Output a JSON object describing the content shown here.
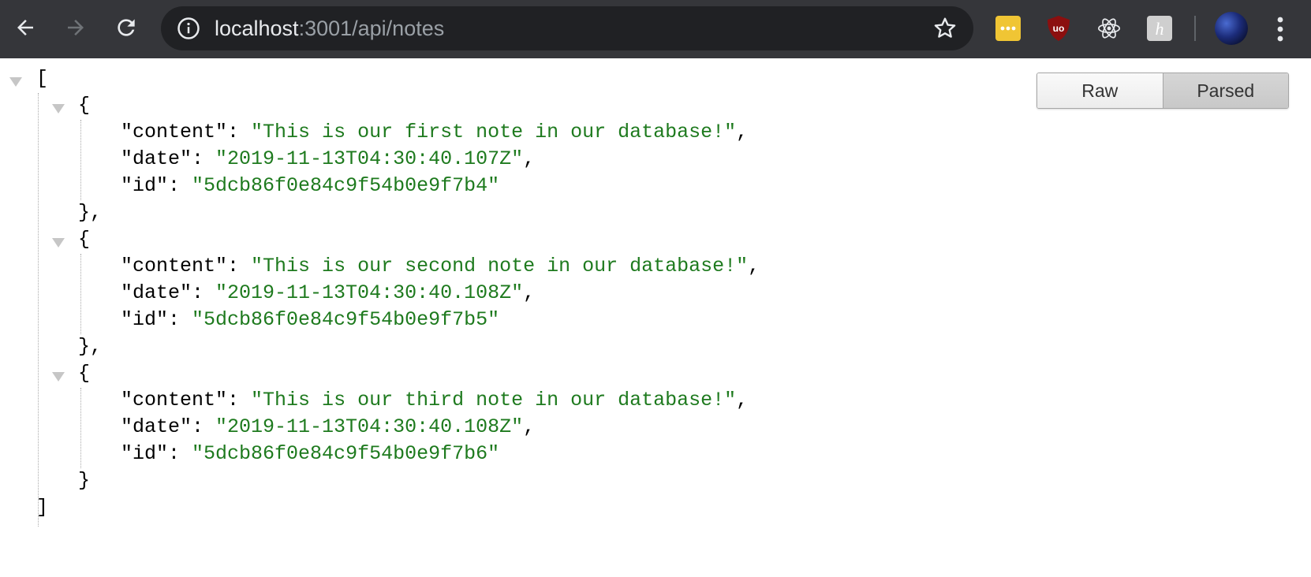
{
  "browser": {
    "url_host": "localhost",
    "url_rest": ":3001/api/notes",
    "icons": [
      "back-arrow-icon",
      "forward-arrow-icon",
      "reload-icon",
      "info-icon",
      "star-icon",
      "menu-dots-icon"
    ],
    "extensions": [
      {
        "name": "lastpass-extension-icon",
        "text": "•••",
        "color": "#f0c534"
      },
      {
        "name": "ublock-origin-extension-icon",
        "text": "uo",
        "color": "#8b0f0f"
      },
      {
        "name": "react-devtools-extension-icon",
        "text": "",
        "color": "#e8eaed"
      },
      {
        "name": "honey-extension-icon",
        "text": "h",
        "color": "#cfcfcf"
      }
    ]
  },
  "viewer": {
    "raw_label": "Raw",
    "parsed_label": "Parsed",
    "selected": "Parsed"
  },
  "json": {
    "open_bracket": "[",
    "close_bracket": "]",
    "notes": [
      {
        "content_key": "\"content\"",
        "content": "\"This is our first note in our database!\"",
        "date_key": "\"date\"",
        "date": "\"2019-11-13T04:30:40.107Z\"",
        "id_key": "\"id\"",
        "id": "\"5dcb86f0e84c9f54b0e9f7b4\"",
        "close": "},"
      },
      {
        "content_key": "\"content\"",
        "content": "\"This is our second note in our database!\"",
        "date_key": "\"date\"",
        "date": "\"2019-11-13T04:30:40.108Z\"",
        "id_key": "\"id\"",
        "id": "\"5dcb86f0e84c9f54b0e9f7b5\"",
        "close": "},"
      },
      {
        "content_key": "\"content\"",
        "content": "\"This is our third note in our database!\"",
        "date_key": "\"date\"",
        "date": "\"2019-11-13T04:30:40.108Z\"",
        "id_key": "\"id\"",
        "id": "\"5dcb86f0e84c9f54b0e9f7b6\"",
        "close": "}"
      }
    ]
  }
}
